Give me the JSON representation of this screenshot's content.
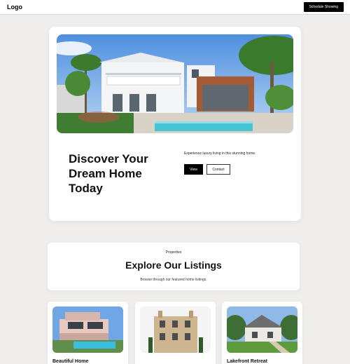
{
  "header": {
    "logo": "Logo",
    "cta_label": "Schedule Showing"
  },
  "hero": {
    "title": "Discover Your Dream Home Today",
    "subtitle": "Experience luxury living in this stunning home.",
    "view_label": "View",
    "contact_label": "Contact"
  },
  "listings": {
    "kicker": "Properties",
    "title": "Explore Our Listings",
    "subtitle": "Browse through our featured home listings."
  },
  "properties": [
    {
      "name": "Beautiful Home"
    },
    {
      "name": ""
    },
    {
      "name": "Lakefront Retreat"
    }
  ]
}
